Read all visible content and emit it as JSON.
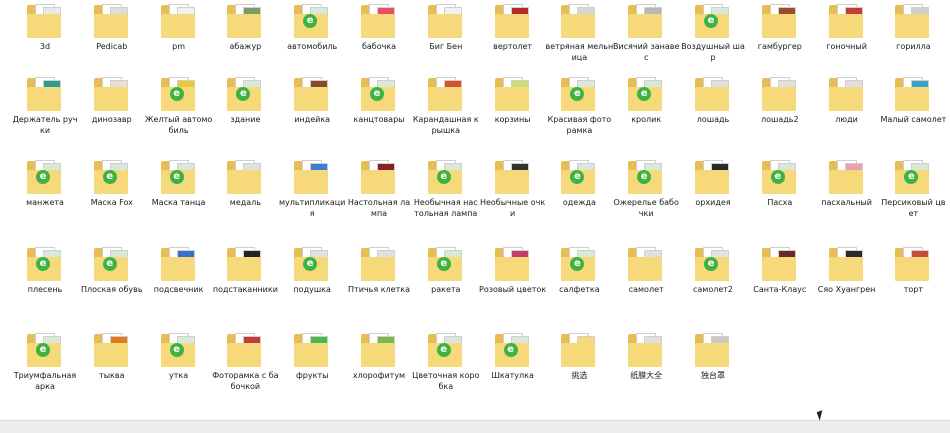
{
  "view": {
    "item_icon": "folder-icon",
    "colors": {
      "folder_back": "#e7bd55",
      "folder_front": "#f6d97b",
      "badge": "#3fb33f"
    },
    "rows": [
      {
        "items": [
          {
            "label": "3d",
            "thumb": "#e9e9e9",
            "badge": false
          },
          {
            "label": "Pedicab",
            "thumb": "#dddddd",
            "badge": false
          },
          {
            "label": "pm",
            "thumb": "#f2f2f2",
            "badge": false
          },
          {
            "label": "абажур",
            "thumb": "#7a9b63",
            "badge": false
          },
          {
            "label": "автомобиль",
            "thumb": "#d9e8d9",
            "badge": true
          },
          {
            "label": "бабочка",
            "thumb": "#e94d6a",
            "badge": false
          },
          {
            "label": "Биг Бен",
            "thumb": "#f0f0f0",
            "badge": false
          },
          {
            "label": "вертолет",
            "thumb": "#b32b2b",
            "badge": false
          },
          {
            "label": "ветряная мельница",
            "thumb": "#d6d6d6",
            "badge": false
          },
          {
            "label": "Висячий занавес",
            "thumb": "#b8b8b8",
            "badge": false
          },
          {
            "label": "Воздушный шар",
            "thumb": "#d9e8d9",
            "badge": true
          },
          {
            "label": "гамбургер",
            "thumb": "#9c4a2a",
            "badge": false
          },
          {
            "label": "гоночный",
            "thumb": "#c83b3b",
            "badge": false
          },
          {
            "label": "горилла",
            "thumb": "#cfcfcf",
            "badge": false
          }
        ]
      },
      {
        "items": [
          {
            "label": "Держатель ручки",
            "thumb": "#2e9c8a",
            "badge": false
          },
          {
            "label": "динозавр",
            "thumb": "#e8e0d0",
            "badge": false
          },
          {
            "label": "Желтый автомобиль",
            "thumb": "#e7c93a",
            "badge": true
          },
          {
            "label": "здание",
            "thumb": "#d9e8d9",
            "badge": true
          },
          {
            "label": "индейка",
            "thumb": "#8a4a2a",
            "badge": false
          },
          {
            "label": "канцтовары",
            "thumb": "#d9e8d9",
            "badge": true
          },
          {
            "label": "Карандашная крышка",
            "thumb": "#d4532b",
            "badge": false
          },
          {
            "label": "корзины",
            "thumb": "#c9e07a",
            "badge": false
          },
          {
            "label": "Красивая фоторамка",
            "thumb": "#d9e8d9",
            "badge": true
          },
          {
            "label": "кролик",
            "thumb": "#d9e8d9",
            "badge": true
          },
          {
            "label": "лошадь",
            "thumb": "#e0e0e0",
            "badge": false
          },
          {
            "label": "лошадь2",
            "thumb": "#e0e0e0",
            "badge": false
          },
          {
            "label": "люди",
            "thumb": "#e0e0e0",
            "badge": false
          },
          {
            "label": "Малый самолет",
            "thumb": "#3fa0c8",
            "badge": false
          }
        ]
      },
      {
        "items": [
          {
            "label": "манжета",
            "thumb": "#d9e8d9",
            "badge": true
          },
          {
            "label": "Маска Fox",
            "thumb": "#d9e8d9",
            "badge": true
          },
          {
            "label": "Маска танца",
            "thumb": "#d9e8d9",
            "badge": true
          },
          {
            "label": "медаль",
            "thumb": "#e0e0e0",
            "badge": false
          },
          {
            "label": "мультипликация",
            "thumb": "#3a7fd0",
            "badge": false
          },
          {
            "label": "Настольная лампа",
            "thumb": "#8a1f2a",
            "badge": false
          },
          {
            "label": "Необычная настольная лампа",
            "thumb": "#d9e8d9",
            "badge": true
          },
          {
            "label": "Необычные очки",
            "thumb": "#333333",
            "badge": false
          },
          {
            "label": "одежда",
            "thumb": "#d9e8d9",
            "badge": true
          },
          {
            "label": "Ожерелье бабочки",
            "thumb": "#d9e8d9",
            "badge": true
          },
          {
            "label": "орхидея",
            "thumb": "#2a2a2a",
            "badge": false
          },
          {
            "label": "Пасха",
            "thumb": "#d9e8d9",
            "badge": true
          },
          {
            "label": "пасхальный",
            "thumb": "#e9a0b0",
            "badge": false
          },
          {
            "label": "Персиковый цвет",
            "thumb": "#d9e8d9",
            "badge": true
          }
        ]
      },
      {
        "items": [
          {
            "label": "плесень",
            "thumb": "#d9e8d9",
            "badge": true
          },
          {
            "label": "Плоская обувь",
            "thumb": "#d9e8d9",
            "badge": true
          },
          {
            "label": "подсвечник",
            "thumb": "#3a6fc8",
            "badge": false
          },
          {
            "label": "подстаканники",
            "thumb": "#222222",
            "badge": false
          },
          {
            "label": "подушка",
            "thumb": "#d9e8d9",
            "badge": true
          },
          {
            "label": "Птичья клетка",
            "thumb": "#e0e0e0",
            "badge": false
          },
          {
            "label": "ракета",
            "thumb": "#d9e8d9",
            "badge": true
          },
          {
            "label": "Розовый цветок",
            "thumb": "#c83a6a",
            "badge": false
          },
          {
            "label": "салфетка",
            "thumb": "#d9e8d9",
            "badge": true
          },
          {
            "label": "самолет",
            "thumb": "#e0e0e0",
            "badge": false
          },
          {
            "label": "самолет2",
            "thumb": "#d9e8d9",
            "badge": true
          },
          {
            "label": "Санта-Клаус",
            "thumb": "#6a2a2a",
            "badge": false
          },
          {
            "label": "Сяо Хуангрен",
            "thumb": "#2a2a2a",
            "badge": false
          },
          {
            "label": "торт",
            "thumb": "#c84a3a",
            "badge": false
          }
        ]
      },
      {
        "items": [
          {
            "label": "Триумфальная арка",
            "thumb": "#d9e8d9",
            "badge": true
          },
          {
            "label": "тыква",
            "thumb": "#e07a1a",
            "badge": false
          },
          {
            "label": "утка",
            "thumb": "#d9e8d9",
            "badge": true
          },
          {
            "label": "Фоторамка с бабочкой",
            "thumb": "#c83a3a",
            "badge": false
          },
          {
            "label": "фрукты",
            "thumb": "#4ab84a",
            "badge": false
          },
          {
            "label": "хлорофитум",
            "thumb": "#7ab84a",
            "badge": false
          },
          {
            "label": "Цветочная коробка",
            "thumb": "#d9e8d9",
            "badge": true
          },
          {
            "label": "Шкатулка",
            "thumb": "#d9e8d9",
            "badge": true
          },
          {
            "label": "挑选",
            "thumb": "#f6d97b",
            "badge": false
          },
          {
            "label": "纸膜大全",
            "thumb": "#e0e0e0",
            "badge": false
          },
          {
            "label": "独台罩",
            "thumb": "#d0c8c0",
            "badge": false
          }
        ]
      }
    ]
  }
}
